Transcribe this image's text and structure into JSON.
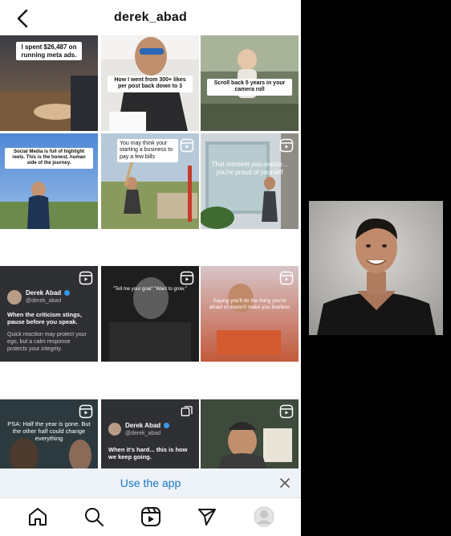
{
  "header": {
    "title": "derek_abad"
  },
  "grid": {
    "t1": {
      "caption": "I spent $26,487 on running meta ads."
    },
    "t2": {
      "caption": "How I went from 300+ likes per post back down to 3"
    },
    "t3": {
      "caption": "Scroll back 5 years in your camera roll"
    },
    "t4": {
      "caption": "Social Media is full of highlight reels. This is the honest, human side of the journey."
    },
    "t5": {
      "caption": "You may think your starting a business to pay a few bills"
    },
    "t6": {
      "caption": "That moment you realize... you're proud of yourself"
    },
    "t7": {
      "author": "Derek Abad",
      "handle": "@derek_abad",
      "headline": "When the criticism stings, pause before you speak.",
      "body": "Quick reaction may protect your ego, but a calm response protects your integrity."
    },
    "t8": {
      "caption": "\"Tell me your goal\" \"Want to grow.\""
    },
    "t9": {
      "caption": "Saying you'll do the thing you're afraid of doesn't make you fearless"
    },
    "t10": {
      "caption": "PSA: Half the year is gone. But the other half could change everything"
    },
    "t11": {
      "author": "Derek Abad",
      "handle": "@derek_abad",
      "headline": "When it's hard... this is how we keep going."
    }
  },
  "banner": {
    "label": "Use the app"
  },
  "colors": {
    "accent": "#1877c2",
    "verified": "#3897f0",
    "banner_bg": "#eef3f9"
  },
  "icons": [
    "back-arrow-icon",
    "reel-icon",
    "close-icon",
    "home-icon",
    "search-icon",
    "reels-icon",
    "send-icon",
    "profile-avatar-icon"
  ]
}
